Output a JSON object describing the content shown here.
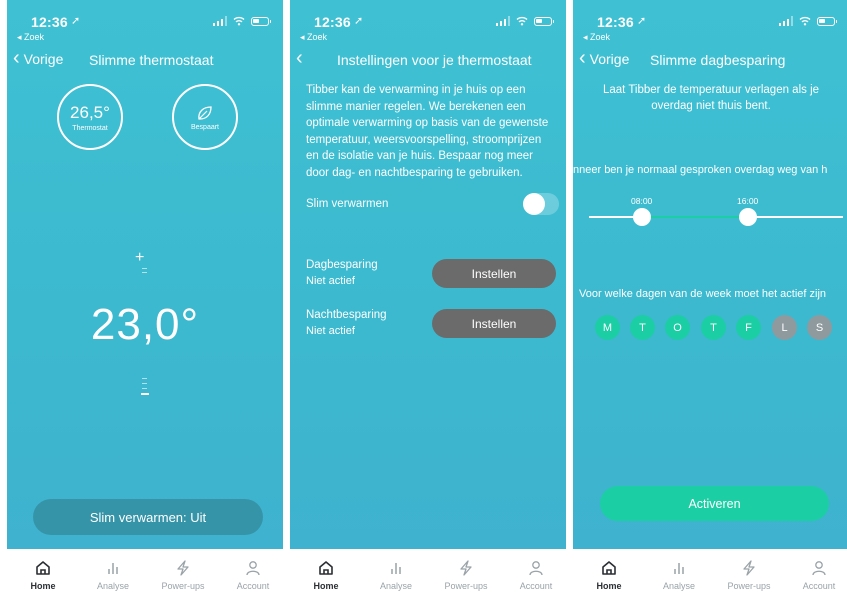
{
  "status": {
    "time": "12:36",
    "back_app": "◂ Zoek"
  },
  "tabs": [
    {
      "label": "Home",
      "icon": "home-icon"
    },
    {
      "label": "Analyse",
      "icon": "bar-chart-icon"
    },
    {
      "label": "Power-ups",
      "icon": "lightning-icon"
    },
    {
      "label": "Account",
      "icon": "person-icon"
    }
  ],
  "screen1": {
    "back_label": "Vorige",
    "title": "Slimme thermostaat",
    "thermostat_value": "26,5°",
    "thermostat_label": "Thermostat",
    "savings_label": "Bespaart",
    "plus": "+",
    "target_temp": "23,0°",
    "smart_heating_button": "Slim verwarmen: Uit"
  },
  "screen2": {
    "title": "Instellingen voor je thermostaat",
    "description": "Tibber kan de verwarming in je huis op een slimme manier regelen. We berekenen een optimale verwarming op basis van de gewenste temperatuur, weersvoorspelling, stroomprijzen en de isolatie van je huis. Bespaar nog meer door dag- en nachtbesparing te gebruiken.",
    "smart_heating_label": "Slim verwarmen",
    "smart_heating_on": false,
    "day_saving_label": "Dagbesparing",
    "day_saving_status": "Niet actief",
    "day_saving_button": "Instellen",
    "night_saving_label": "Nachtbesparing",
    "night_saving_status": "Niet actief",
    "night_saving_button": "Instellen"
  },
  "screen3": {
    "back_label": "Vorige",
    "title": "Slimme dagbesparing",
    "intro": "Laat Tibber de temperatuur verlagen als je overdag niet thuis bent.",
    "question_time": "nneer ben je normaal gesproken overdag weg van h",
    "time_start": "08:00",
    "time_end": "16:00",
    "question_days": "Voor welke dagen van de week moet het actief zijn",
    "days": [
      {
        "label": "M",
        "active": true
      },
      {
        "label": "T",
        "active": true
      },
      {
        "label": "O",
        "active": true
      },
      {
        "label": "T",
        "active": true
      },
      {
        "label": "F",
        "active": true
      },
      {
        "label": "L",
        "active": false
      },
      {
        "label": "S",
        "active": false
      }
    ],
    "activate_button": "Activeren"
  },
  "colors": {
    "accent_green": "#1ccea4",
    "background_teal": "#3fc1d3",
    "button_gray": "#6b6b6b"
  }
}
